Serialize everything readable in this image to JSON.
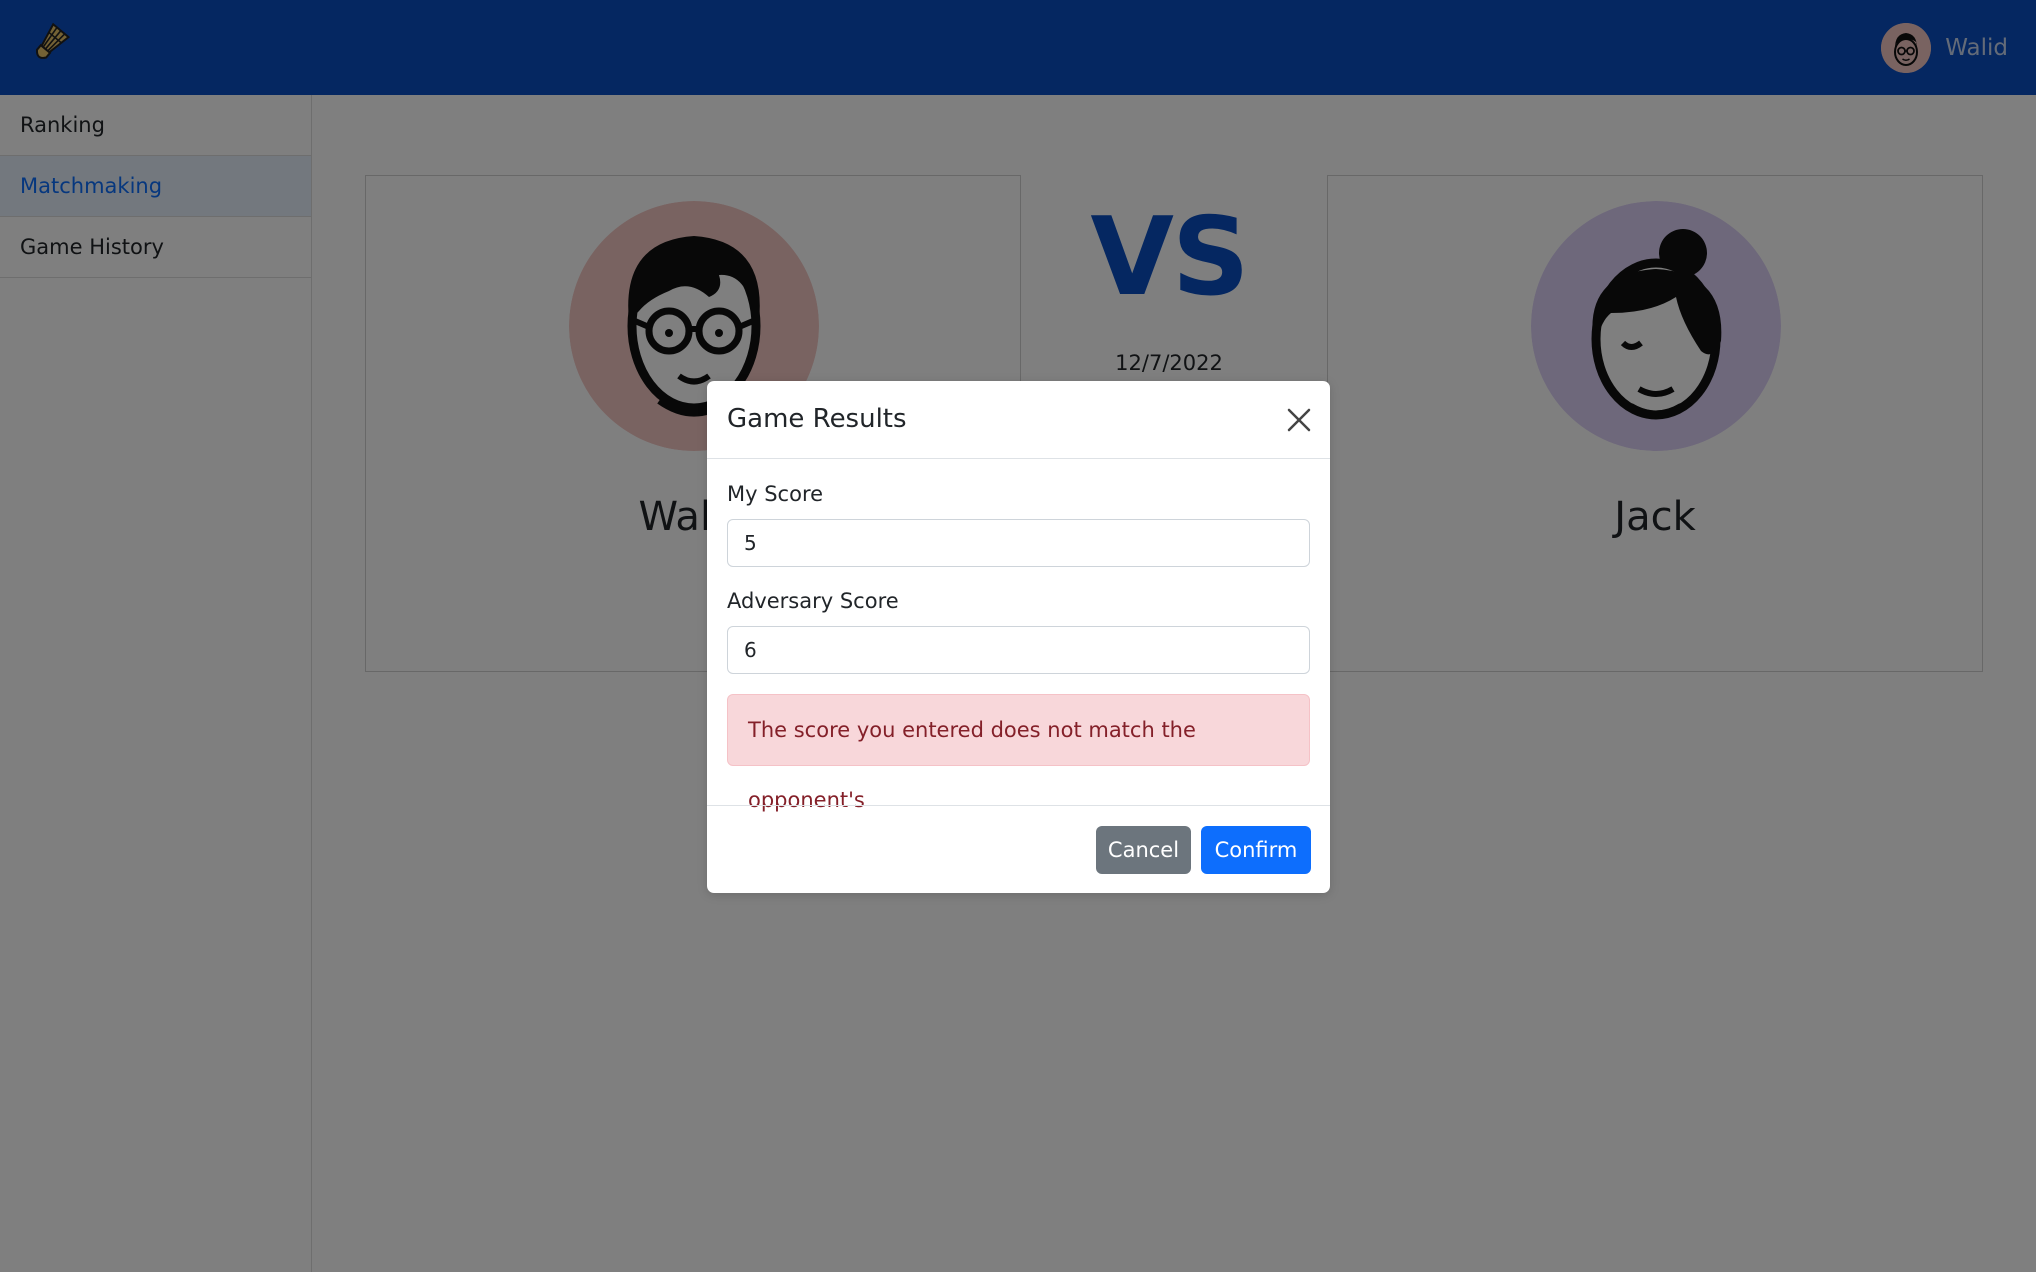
{
  "header": {
    "logo_icon": "badminton-shuttlecock-icon",
    "user": {
      "name": "Walid",
      "avatar_icon": "user-avatar-glasses-icon"
    }
  },
  "sidebar": {
    "items": [
      {
        "label": "Ranking",
        "active": false
      },
      {
        "label": "Matchmaking",
        "active": true
      },
      {
        "label": "Game History",
        "active": false
      }
    ]
  },
  "match": {
    "player1": {
      "name": "Walid",
      "avatar_bg": "#f3c7c3",
      "avatar_icon": "male-avatar-glasses-icon"
    },
    "player2": {
      "name": "Jack",
      "avatar_bg": "#ddd0f7",
      "avatar_icon": "female-avatar-bun-icon"
    },
    "vs_label": "VS",
    "date": "12/7/2022"
  },
  "modal": {
    "title": "Game Results",
    "my_score_label": "My Score",
    "my_score_value": "5",
    "adversary_score_label": "Adversary Score",
    "adversary_score_value": "6",
    "error_message": "The score you entered does not match the opponent's",
    "cancel_label": "Cancel",
    "confirm_label": "Confirm"
  },
  "colors": {
    "navbar": "#0a4fc2",
    "primary": "#0d6efd",
    "secondary": "#6c757d",
    "danger_bg": "#f8d7da",
    "danger_text": "#842029"
  }
}
